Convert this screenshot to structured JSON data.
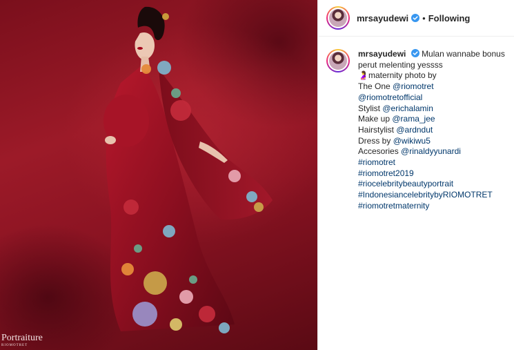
{
  "header": {
    "username": "mrsayudewi",
    "separator": "•",
    "follow_label": "Following"
  },
  "photo": {
    "watermark_main": "Portraiture",
    "watermark_sub": "RIOMOTRET"
  },
  "caption": {
    "username": "mrsayudewi",
    "first_text": "Mulan wannabe bonus",
    "second_text": "perut melenting yessss",
    "lines": [
      {
        "prefix": "🤰maternity photo by",
        "link": ""
      },
      {
        "prefix": "The One ",
        "link": "@riomotret"
      },
      {
        "prefix": "",
        "link": "@riomotretofficial"
      },
      {
        "prefix": "Stylist ",
        "link": "@erichalamin"
      },
      {
        "prefix": "Make up ",
        "link": "@rama_jee"
      },
      {
        "prefix": "Hairstylist ",
        "link": "@ardndut"
      },
      {
        "prefix": "Dress by ",
        "link": "@wikiwu5"
      },
      {
        "prefix": "Accesories ",
        "link": "@rinaldyyunardi"
      },
      {
        "prefix": "",
        "link": "#riomotret"
      },
      {
        "prefix": "",
        "link": "#riomotret2019"
      },
      {
        "prefix": "",
        "link": "#riocelebritybeautyportrait"
      },
      {
        "prefix": "",
        "link": "#IndonesiancelebritybyRIOMOTRET"
      },
      {
        "prefix": "",
        "link": "#riomotretmaternity"
      }
    ]
  },
  "icons": {
    "verified": "verified-badge-icon"
  },
  "colors": {
    "link": "#00376b",
    "verified": "#3897f0",
    "photo_background": "#8a1322"
  }
}
